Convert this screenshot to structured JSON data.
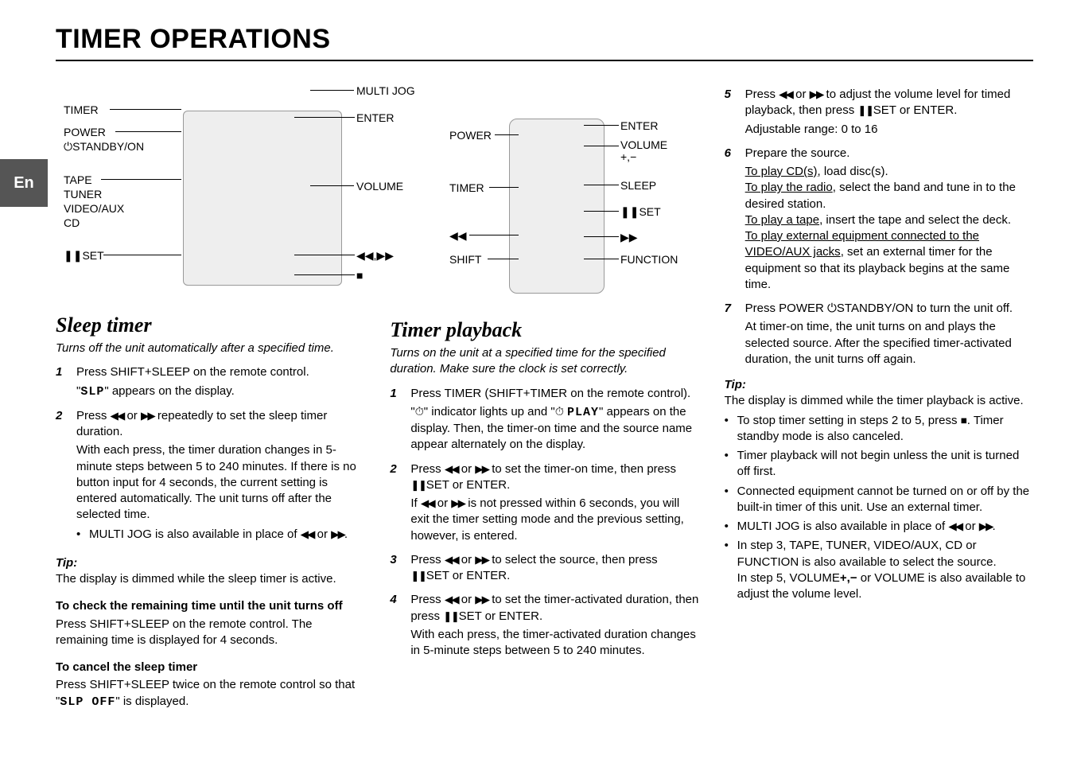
{
  "lang_tab": "En",
  "title": "TIMER OPERATIONS",
  "diagram": {
    "left_labels": [
      "TIMER",
      "POWER",
      "⏻STANDBY/ON",
      "TAPE",
      "TUNER",
      "VIDEO/AUX",
      "CD",
      "❚❚SET"
    ],
    "top_labels": [
      "MULTI JOG",
      "ENTER"
    ],
    "mid_labels": [
      "VOLUME",
      "◀◀,▶▶",
      "■"
    ],
    "remote_left": [
      "POWER",
      "TIMER",
      "◀◀",
      "SHIFT"
    ],
    "remote_right": [
      "ENTER",
      "VOLUME +,−",
      "SLEEP",
      "❚❚SET",
      "▶▶",
      "FUNCTION"
    ]
  },
  "sleep": {
    "heading": "Sleep timer",
    "sub": "Turns off the unit automatically after a specified time.",
    "steps": [
      {
        "n": "1",
        "lead": "Press SHIFT+SLEEP on the remote control.",
        "body": [
          "\"SLP\" appears on the display."
        ],
        "seg_idx": 0
      },
      {
        "n": "2",
        "lead_pre": "Press ",
        "lead_mid": " or ",
        "lead_post": " repeatedly to set the sleep timer duration.",
        "body": [
          "With each press, the timer duration changes in 5-minute steps between 5 to 240 minutes. If there is no button input for 4 seconds, the current setting is entered automatically. The unit turns off after the selected time."
        ],
        "bullet": "MULTI JOG is also available in place of "
      }
    ],
    "tip_label": "Tip:",
    "tip_text": "The display is dimmed while the sleep timer is active.",
    "check_head": "To check the remaining time until the unit turns off",
    "check_body": "Press SHIFT+SLEEP on the remote control. The remaining time is displayed for 4 seconds.",
    "cancel_head": "To cancel the sleep timer",
    "cancel_body_pre": "Press SHIFT+SLEEP twice on the remote control so that \"",
    "cancel_seg": "SLP OFF",
    "cancel_body_post": "\" is displayed."
  },
  "playback": {
    "heading": "Timer playback",
    "sub": "Turns on the unit at a specified time for the specified duration. Make sure the clock is set correctly.",
    "step1": {
      "n": "1",
      "lead": "Press TIMER (SHIFT+TIMER on the remote control).",
      "body_pre": "\"",
      "body_mid1": "\" indicator lights up and \"",
      "body_seg": "PLAY",
      "body_mid2": "\" appears on the display. Then, the timer-on time and the source name appear alternately on the display."
    },
    "step2": {
      "n": "2",
      "lead_pre": "Press ",
      "lead_mid": " or ",
      "lead_post": " to set the timer-on time, then press ",
      "lead_end": "SET or ENTER.",
      "body_pre": "If ",
      "body_mid": " or ",
      "body_post": " is not pressed within 6 seconds, you will exit the timer setting mode and the previous setting, however, is entered."
    },
    "step3": {
      "n": "3",
      "lead_pre": "Press ",
      "lead_mid": " or ",
      "lead_post": " to select the source, then press ",
      "lead_end": "SET or ENTER."
    },
    "step4": {
      "n": "4",
      "lead_pre": "Press ",
      "lead_mid": " or ",
      "lead_post": " to set the timer-activated duration, then press ",
      "lead_end": "SET or ENTER.",
      "body": "With each press, the timer-activated duration changes in 5-minute steps between 5 to 240 minutes."
    }
  },
  "right": {
    "step5": {
      "n": "5",
      "lead_pre": "Press ",
      "lead_mid": " or ",
      "lead_post": " to adjust the volume level for timed playback, then press ",
      "lead_end": "SET or ENTER.",
      "body": "Adjustable range: 0 to 16"
    },
    "step6": {
      "n": "6",
      "lead": "Prepare the source.",
      "lines": [
        {
          "u": "To play CD(s)",
          "rest": ", load disc(s)."
        },
        {
          "u": "To play the radio",
          "rest": ", select the band and tune in to the desired station."
        },
        {
          "u": "To play a tape",
          "rest": ", insert the tape and select the deck."
        },
        {
          "u": "To play external equipment connected to the VIDEO/AUX jacks",
          "rest": ", set an external timer for the equipment so that its playback begins at the same time."
        }
      ]
    },
    "step7": {
      "n": "7",
      "lead_pre": "Press POWER ",
      "lead_post": "STANDBY/ON to turn the unit off.",
      "body": "At timer-on time, the unit turns on and plays the selected source. After the specified timer-activated duration, the unit turns off again."
    },
    "tip_label": "Tip:",
    "tip_text": "The display is dimmed while the timer playback is active.",
    "bullets": [
      {
        "pre": "To stop timer setting in steps 2 to 5, press ",
        "stop": true,
        "post": ". Timer standby mode is also canceled."
      },
      {
        "text": "Timer playback will not begin unless the unit is turned off first."
      },
      {
        "text": "Connected equipment cannot be turned on or off by the built-in timer of this unit. Use an external timer."
      },
      {
        "pre": "MULTI JOG is also available in place of ",
        "arrows": true,
        "post": "."
      },
      {
        "text_a": "In step 3, TAPE, TUNER, VIDEO/AUX, CD or FUNCTION is also available to select the source.",
        "text_b_pre": "In step 5, VOLUME",
        "text_b_mid": "+,−",
        "text_b_post": " or VOLUME is also available to adjust the volume level."
      }
    ]
  }
}
